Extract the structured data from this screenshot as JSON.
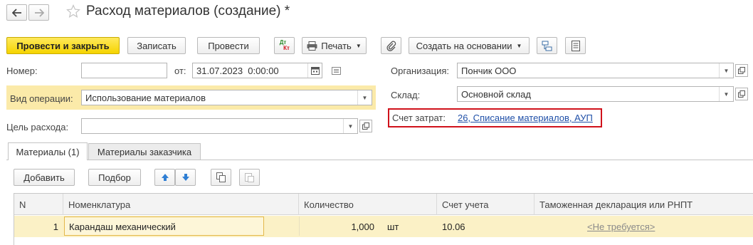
{
  "window": {
    "title": "Расход материалов (создание) *"
  },
  "nav": {
    "back_icon": "arrow-left-icon",
    "forward_icon": "arrow-right-icon",
    "favorite_icon": "star-icon"
  },
  "toolbar": {
    "post_close": "Провести и закрыть",
    "save": "Записать",
    "post": "Провести",
    "dtkt_top": "Дт",
    "dtkt_bottom": "Кт",
    "print": "Печать",
    "create_based_on": "Создать на основании"
  },
  "header": {
    "number_label": "Номер:",
    "number_value": "",
    "date_label": "от:",
    "date_value": "31.07.2023  0:00:00",
    "org_label": "Организация:",
    "org_value": "Пончик ООО",
    "operation_label": "Вид операции:",
    "operation_value": "Использование материалов",
    "warehouse_label": "Склад:",
    "warehouse_value": "Основной склад",
    "purpose_label": "Цель расхода:",
    "purpose_value": "",
    "cost_account_label": "Счет затрат:",
    "cost_account_value": "26, Списание материалов, АУП"
  },
  "tabs": [
    {
      "label": "Материалы (1)",
      "active": true
    },
    {
      "label": "Материалы заказчика",
      "active": false
    }
  ],
  "table_toolbar": {
    "add": "Добавить",
    "pick": "Подбор"
  },
  "table": {
    "columns": [
      "N",
      "Номенклатура",
      "Количество",
      "Счет учета",
      "Таможенная декларация или РНПТ"
    ],
    "rows": [
      {
        "n": "1",
        "item": "Карандаш механический",
        "qty": "1,000",
        "unit": "шт",
        "account": "10.06",
        "customs": "<Не требуется>"
      }
    ]
  },
  "colors": {
    "primary": "#f5d400",
    "highlight_row": "#fbf1c6",
    "link": "#2050a8",
    "border_red": "#d0121b"
  }
}
